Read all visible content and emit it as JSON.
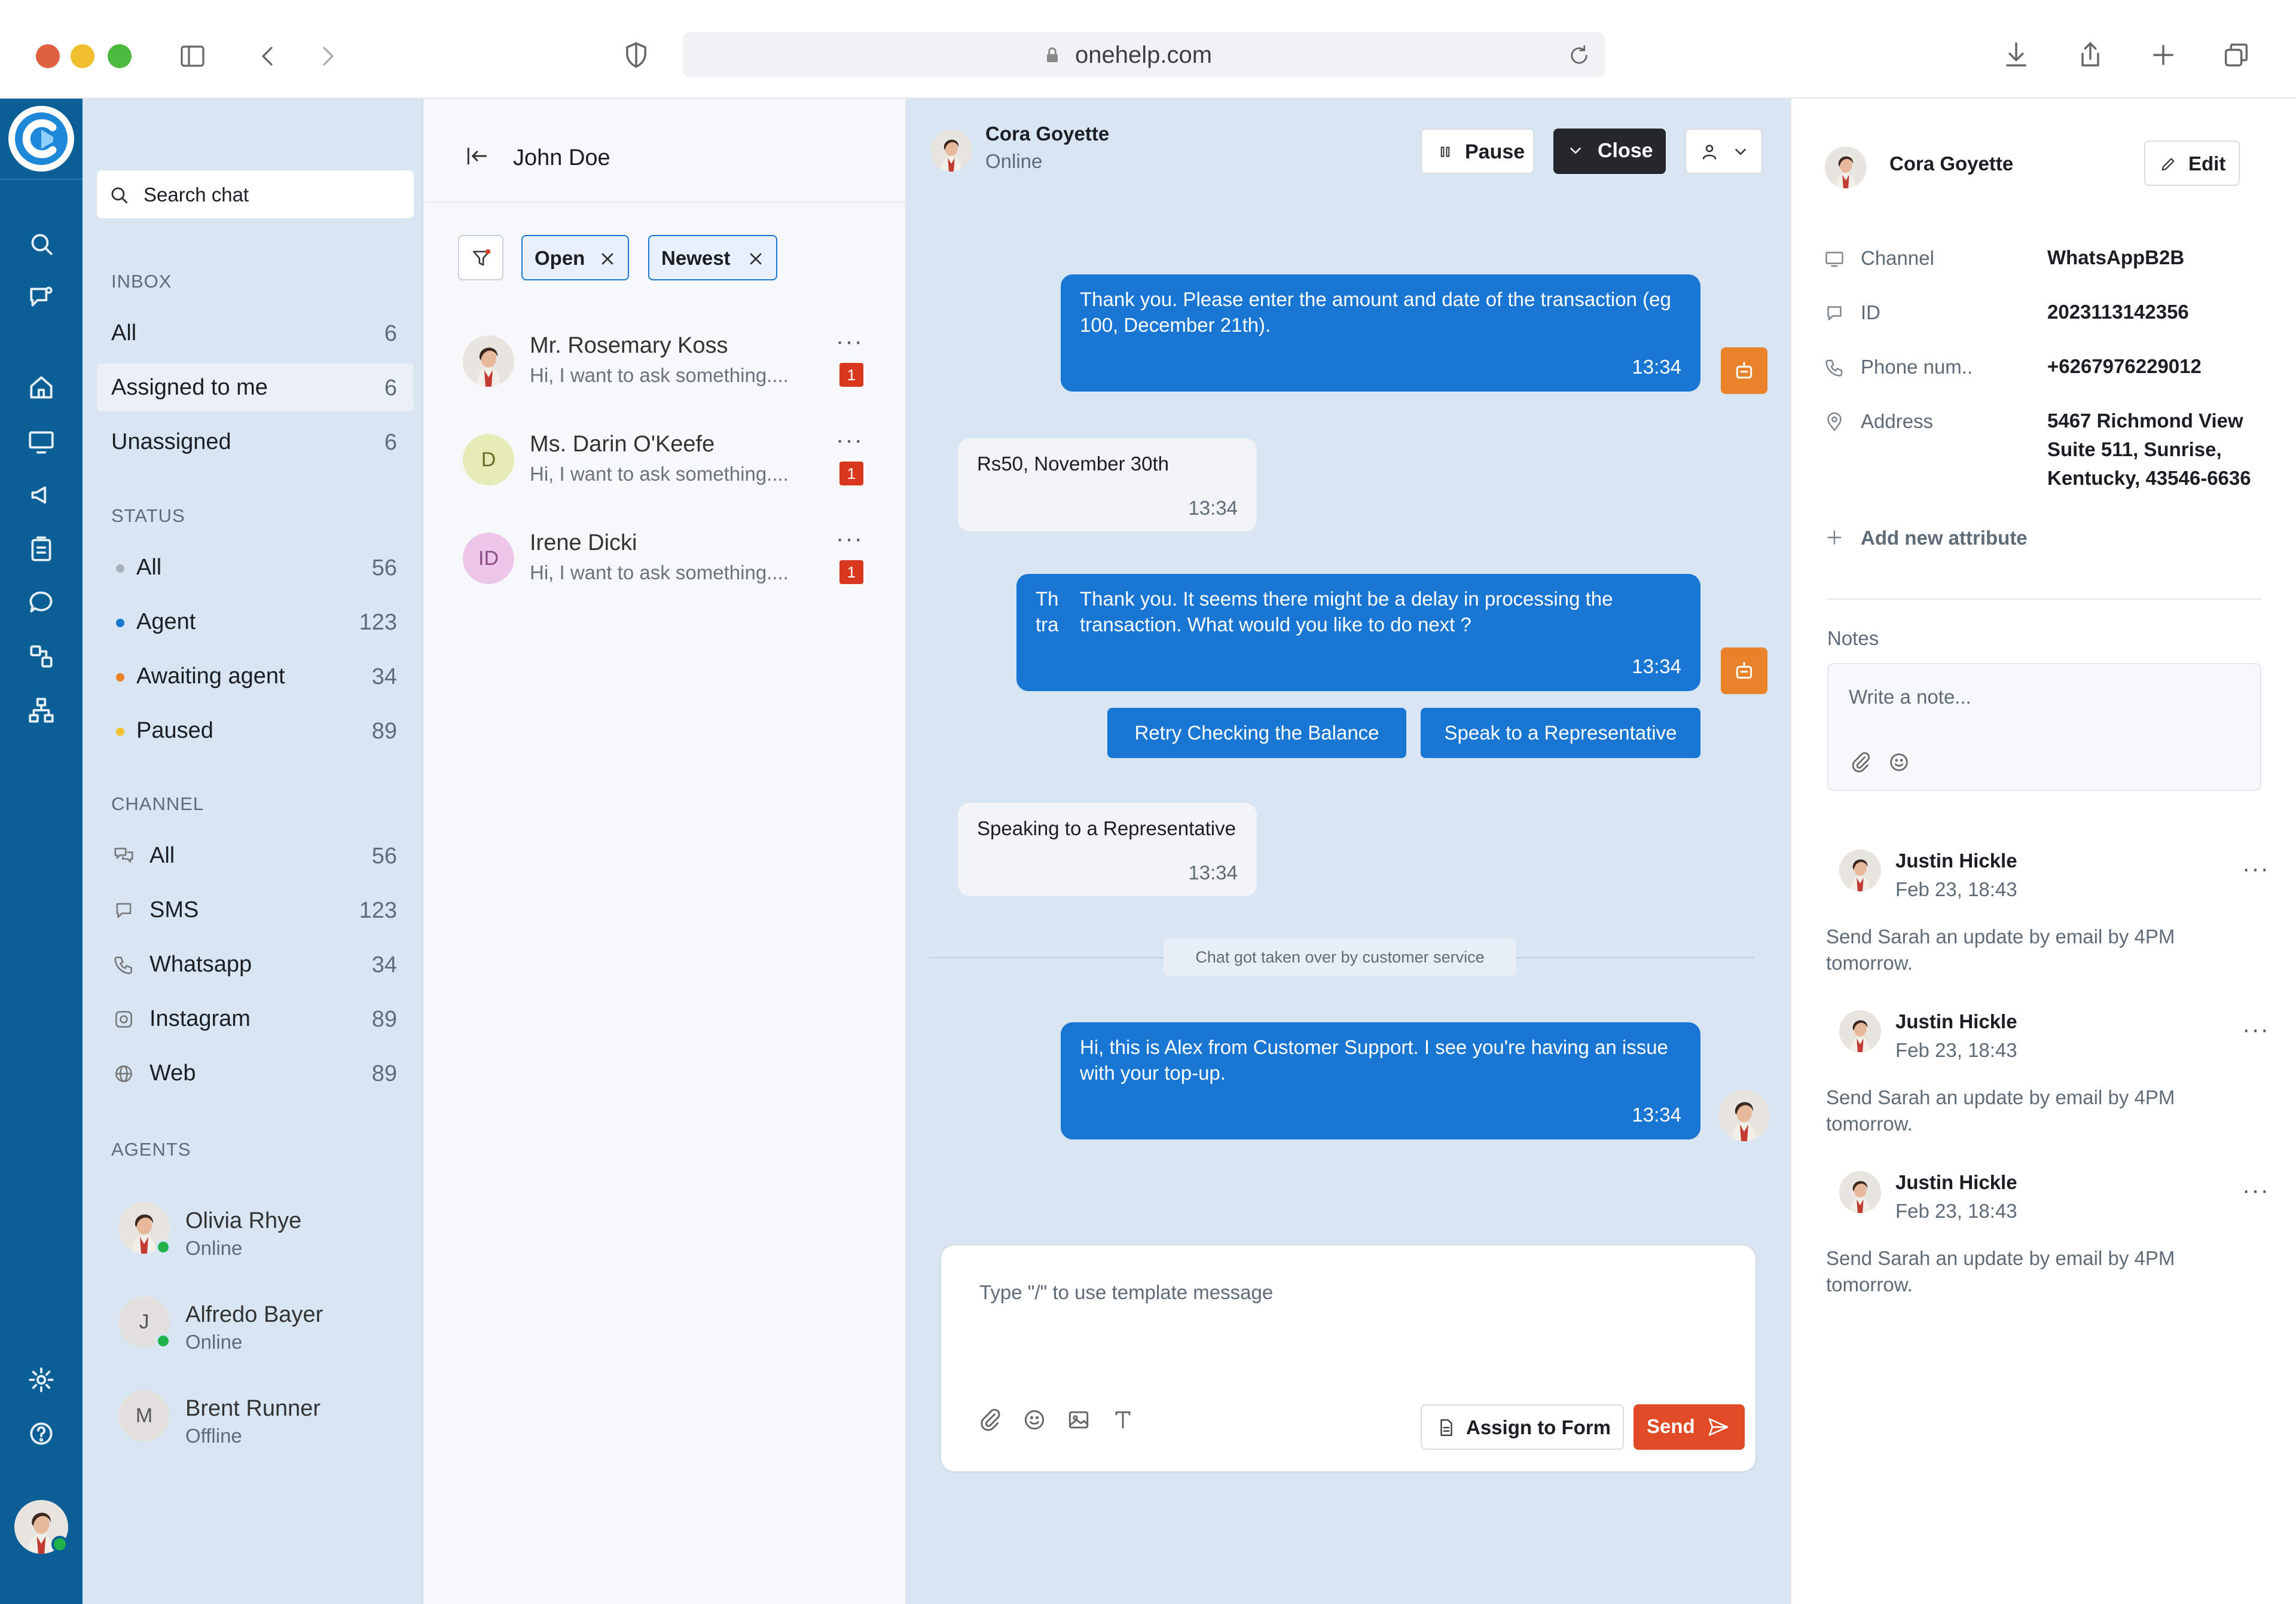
{
  "browser": {
    "url": "onehelp.com"
  },
  "sidebar": {
    "search_placeholder": "Search chat",
    "inbox_title": "INBOX",
    "inbox": [
      {
        "label": "All",
        "count": "6"
      },
      {
        "label": "Assigned to me",
        "count": "6"
      },
      {
        "label": "Unassigned",
        "count": "6"
      }
    ],
    "status_title": "STATUS",
    "status": [
      {
        "label": "All",
        "count": "56",
        "color": "#a9b0b7"
      },
      {
        "label": "Agent",
        "count": "123",
        "color": "#1976d2"
      },
      {
        "label": "Awaiting agent",
        "count": "34",
        "color": "#e8832c"
      },
      {
        "label": "Paused",
        "count": "89",
        "color": "#f2c230"
      }
    ],
    "channel_title": "CHANNEL",
    "channels": [
      {
        "label": "All",
        "count": "56",
        "icon": "chats-icon"
      },
      {
        "label": "SMS",
        "count": "123",
        "icon": "message-icon"
      },
      {
        "label": "Whatsapp",
        "count": "34",
        "icon": "phone-icon"
      },
      {
        "label": "Instagram",
        "count": "89",
        "icon": "instagram-icon"
      },
      {
        "label": "Web",
        "count": "89",
        "icon": "globe-icon"
      }
    ],
    "agents_title": "AGENTS",
    "agents": [
      {
        "name": "Olivia Rhye",
        "status": "Online",
        "initial": ""
      },
      {
        "name": "Alfredo Bayer",
        "status": "Online",
        "initial": "J"
      },
      {
        "name": "Brent Runner",
        "status": "Offline",
        "initial": "M"
      }
    ]
  },
  "list": {
    "title": "John Doe",
    "chips": [
      "Open",
      "Newest"
    ],
    "conversations": [
      {
        "name": "Mr. Rosemary Koss",
        "preview": "Hi, I want to ask something....",
        "badge": "1",
        "initial": "",
        "bg": "#e3e1de"
      },
      {
        "name": "Ms. Darin O'Keefe",
        "preview": "Hi, I want to ask something....",
        "badge": "1",
        "initial": "D",
        "bg": "#e5ecb8"
      },
      {
        "name": "Irene Dicki",
        "preview": "Hi, I want to ask something....",
        "badge": "1",
        "initial": "ID",
        "bg": "#edc6ea"
      }
    ]
  },
  "chat": {
    "contact_name": "Cora Goyette",
    "contact_status": "Online",
    "pause_label": "Pause",
    "close_label": "Close",
    "messages": {
      "m1": {
        "text": "Thank you. Please enter the amount and date of the transaction (eg 100, December 21th).",
        "time": "13:34"
      },
      "m2": {
        "text": "Rs50, November 30th",
        "time": "13:34"
      },
      "m3": {
        "prefix": "Th\ntra",
        "text": "Thank you. It seems there might be a delay in processing the transaction. What would you like to do next ?",
        "time": "13:34"
      },
      "m4": {
        "text": "Speaking to a Representative",
        "time": "13:34"
      },
      "m5": {
        "text": "Hi, this is Alex from Customer Support. I see you're having an issue with your top-up.",
        "time": "13:34"
      }
    },
    "quick_replies": [
      "Retry Checking the Balance",
      "Speak to a Representative"
    ],
    "system_note": "Chat got taken over by customer service",
    "composer_placeholder": "Type \"/\" to use template message",
    "assign_label": "Assign to Form",
    "send_label": "Send"
  },
  "right": {
    "contact_name": "Cora Goyette",
    "edit_label": "Edit",
    "attributes": [
      {
        "key": "Channel",
        "value": "WhatsAppB2B"
      },
      {
        "key": "ID",
        "value": "2023113142356"
      },
      {
        "key": "Phone num..",
        "value": "+6267976229012"
      },
      {
        "key": "Address",
        "value": "5467 Richmond View Suite 511, Sunrise, Kentucky, 43546-6636"
      }
    ],
    "add_attribute_label": "Add new attribute",
    "notes_title": "Notes",
    "note_placeholder": "Write a note...",
    "notes": [
      {
        "author": "Justin Hickle",
        "date": "Feb 23, 18:43",
        "text": "Send Sarah an update by email by 4PM tomorrow."
      },
      {
        "author": "Justin Hickle",
        "date": "Feb 23, 18:43",
        "text": "Send Sarah an update by email by 4PM tomorrow."
      },
      {
        "author": "Justin Hickle",
        "date": "Feb 23, 18:43",
        "text": "Send Sarah an update by email by 4PM tomorrow."
      }
    ]
  },
  "colors": {
    "brand": "#0b5f97",
    "accent": "#1976d2",
    "send": "#e04a24",
    "bot": "#e8832c",
    "panel": "#d8e6f3"
  }
}
